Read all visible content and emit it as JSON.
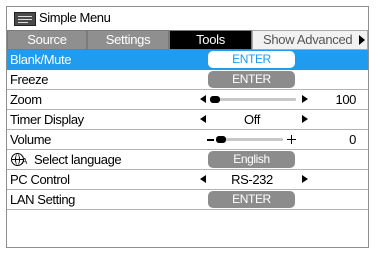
{
  "window": {
    "title": "Simple Menu",
    "icon": "menu-list-icon"
  },
  "tabs": [
    {
      "label": "Source",
      "state": "inactive"
    },
    {
      "label": "Settings",
      "state": "inactive"
    },
    {
      "label": "Tools",
      "state": "active"
    },
    {
      "label": "Show Advanced",
      "state": "inactive"
    }
  ],
  "items": {
    "blank_mute": {
      "label": "Blank/Mute",
      "button": "ENTER",
      "selected": true
    },
    "freeze": {
      "label": "Freeze",
      "button": "ENTER"
    },
    "zoom": {
      "label": "Zoom",
      "value": "100",
      "level": 0.0
    },
    "timer_display": {
      "label": "Timer Display",
      "value": "Off"
    },
    "volume": {
      "label": "Volume",
      "value": "0",
      "level": 0.0
    },
    "select_language": {
      "label": "Select language",
      "value": "English",
      "icon": "globe-icon"
    },
    "pc_control": {
      "label": "PC Control",
      "value": "RS-232"
    },
    "lan_setting": {
      "label": "LAN Setting",
      "button": "ENTER"
    }
  },
  "colors": {
    "selection": "#1f9cf0",
    "button": "#8c8c8c",
    "active_tab": "#000000"
  }
}
